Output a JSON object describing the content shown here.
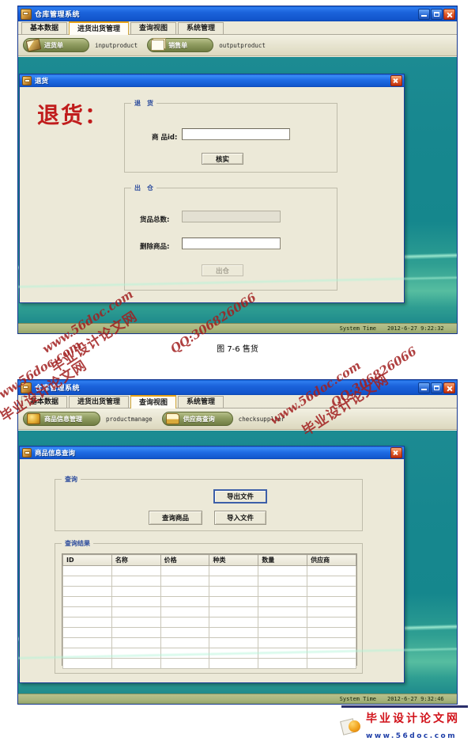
{
  "app": {
    "window_title": "仓库管理系统",
    "window_buttons": {
      "minimize": "minimize-button",
      "maximize": "maximize-button",
      "close": "close-button"
    }
  },
  "window1": {
    "title": "仓库管理系统",
    "tabs": [
      {
        "label": "基本数据",
        "active": false
      },
      {
        "label": "进货出货管理",
        "active": true
      },
      {
        "label": "查询视图",
        "active": false
      },
      {
        "label": "系统管理",
        "active": false
      }
    ],
    "toolbar": [
      {
        "label": "进货单",
        "code": "inputproduct",
        "icon": "broom-icon"
      },
      {
        "label": "销售单",
        "code": "outputproduct",
        "icon": "documents-icon"
      }
    ],
    "dialog": {
      "title": "退货",
      "heading": "退货：",
      "group_return": {
        "legend": "退　货",
        "field_label": "商 品id:",
        "field_value": "",
        "button": "核实"
      },
      "group_out": {
        "legend": "出　仓",
        "total_label": "货品总数:",
        "total_value": "",
        "delete_label": "删除商品:",
        "delete_value": "",
        "button": "出仓"
      }
    },
    "statusbar": {
      "label": "System Time",
      "value": "2012-6-27 9:22:32"
    }
  },
  "figure_caption": "图 7-6 售货",
  "window2": {
    "title": "仓库管理系统",
    "tabs": [
      {
        "label": "基本数据",
        "active": false
      },
      {
        "label": "进货出货管理",
        "active": false
      },
      {
        "label": "查询视图",
        "active": true
      },
      {
        "label": "系统管理",
        "active": false
      }
    ],
    "toolbar": [
      {
        "label": "商品信息管理",
        "code": "productmanage",
        "icon": "boxes-icon"
      },
      {
        "label": "供应商查询",
        "code": "checksupplier",
        "icon": "truck-icon"
      }
    ],
    "dialog": {
      "title": "商品信息查询",
      "group_query": {
        "legend": "查询",
        "export_button": "导出文件",
        "query_button": "查询商品",
        "import_button": "导入文件"
      },
      "group_result": {
        "legend": "查询结果",
        "columns": [
          "ID",
          "名称",
          "价格",
          "种类",
          "数量",
          "供应商"
        ],
        "row_count": 10
      }
    },
    "statusbar": {
      "label": "System Time",
      "value": "2012-6-27 9:32:46"
    }
  },
  "watermarks": {
    "cn": "毕业设计论文网",
    "site": "www.56doc.com",
    "qq": "QQ:306826066"
  },
  "footer": {
    "cn": "毕业设计论文网",
    "en": "www.56doc.com"
  },
  "colors": {
    "titlebar_blue": "#1b63db",
    "desktop_teal": "#17878f",
    "panel_beige": "#ece9d8",
    "toolbar_green": "#93a064",
    "accent_red": "#c01c1c",
    "status_green": "#a7b47c",
    "focus_blue": "#3d5fa8"
  }
}
